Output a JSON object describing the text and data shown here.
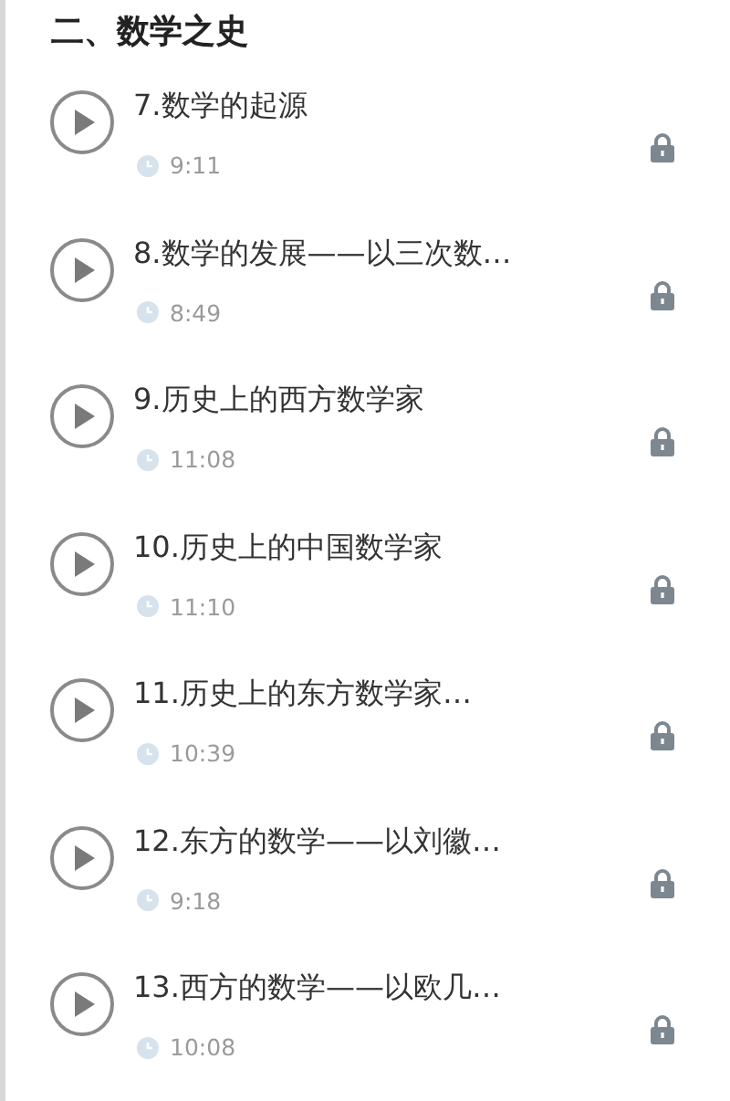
{
  "section_title": "二、数学之史",
  "lessons": [
    {
      "title": "7.数学的起源",
      "duration": "9:11",
      "locked": true
    },
    {
      "title": "8.数学的发展——以三次数…",
      "duration": "8:49",
      "locked": true
    },
    {
      "title": "9.历史上的西方数学家",
      "duration": "11:08",
      "locked": true
    },
    {
      "title": "10.历史上的中国数学家",
      "duration": "11:10",
      "locked": true
    },
    {
      "title": "11.历史上的东方数学家…",
      "duration": "10:39",
      "locked": true
    },
    {
      "title": "12.东方的数学——以刘徽…",
      "duration": "9:18",
      "locked": true
    },
    {
      "title": "13.西方的数学——以欧几…",
      "duration": "10:08",
      "locked": true
    }
  ]
}
